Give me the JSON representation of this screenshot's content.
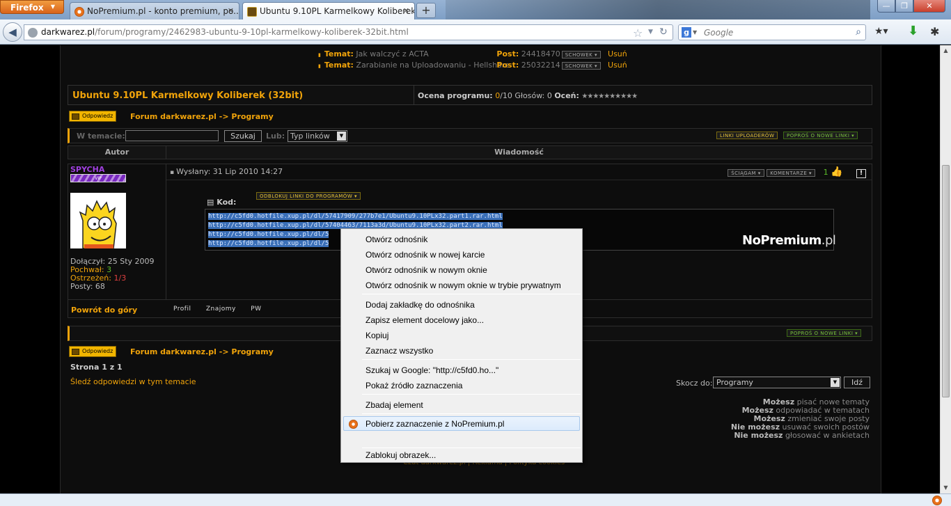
{
  "browser": {
    "app_button": "Firefox",
    "tabs": [
      {
        "title": "NoPremium.pl - konto premium, po...",
        "active": false
      },
      {
        "title": "Ubuntu 9.10PL Karmelkowy Koliberek...",
        "active": true
      }
    ],
    "url_host": "darkwarez.pl",
    "url_path": "/forum/programy/2462983-ubuntu-9-10pl-karmelkowy-koliberek-32bit.html",
    "search_placeholder": "Google",
    "window_controls": {
      "minimize": "—",
      "maximize": "❐",
      "close": "✕"
    }
  },
  "related": [
    {
      "label": "Temat:",
      "title": "Jak walczyć z ACTA",
      "post_label": "Post:",
      "post": "24418470",
      "clip": "SCHOWEK ▾",
      "remove": "Usuń"
    },
    {
      "label": "Temat:",
      "title": "Zarabianie na Uploadowaniu - Hellshare",
      "post_label": "Post:",
      "post": "25032214",
      "clip": "SCHOWEK ▾",
      "remove": "Usuń"
    }
  ],
  "topic": {
    "title": "Ubuntu 9.10PL Karmelkowy Koliberek (32bit)",
    "rating_label": "Ocena programu:",
    "rating_value": "0",
    "rating_max": "/10",
    "votes": "Głosów: 0",
    "rate_label": "Oceń:",
    "stars": "★★★★★★★★★★"
  },
  "nav": {
    "reply_button": "Odpowiedz",
    "crumb_forum": "Forum darkwarez.pl",
    "crumb_sep": "->",
    "crumb_section": "Programy"
  },
  "search": {
    "label": "W temacie:",
    "button": "Szukaj",
    "or_label": "Lub:",
    "select_value": "Typ linków",
    "uploaders_button": "LINKI UPLOADERÓW",
    "request_links_button": "POPROŚ O NOWE LINKI ▾"
  },
  "table": {
    "author_header": "Autor",
    "message_header": "Wiadomość"
  },
  "post": {
    "author": "SPYCHA",
    "badge": "VIP",
    "joined": "Dołączył: 25 Sty 2009",
    "praise_label": "Pochwał:",
    "praise": "3",
    "warnings_label": "Ostrzeżeń:",
    "warnings": "1/3",
    "posts": "Posty: 68",
    "posted": "Wysłany: 31 Lip 2010 14:27",
    "download_button": "ŚCIĄGAM ▾",
    "comments_button": "KOMENTARZE ▾",
    "thumbs": "1",
    "report": "!",
    "code_label": "Kod:",
    "unlock_button": "ODBLOKUJ LINKI DO PROGRAMÓW ▾",
    "code_lines": [
      "http://c5fd0.hotfile.xup.pl/dl/57417909/277b7e1/Ubuntu9.10PLx32.part1.rar.html",
      "http://c5fd0.hotfile.xup.pl/dl/57404463/7113a3d/Ubuntu9.10PLx32.part2.rar.html",
      "http://c5fd0.hotfile.xup.pl/dl/5",
      "http://c5fd0.hotfile.xup.pl/dl/5"
    ],
    "watermark_main": "NoPremium",
    "watermark_tld": ".pl"
  },
  "post_footer": {
    "back_to_top": "Powrót do góry",
    "profile": "Profil",
    "friends": "Znajomy",
    "pm": "PW"
  },
  "pagination": "Strona 1 z 1",
  "follow": "Śledź odpowiedzi w tym temacie",
  "jump": {
    "label": "Skocz do:",
    "value": "Programy",
    "button": "Idź"
  },
  "permissions": [
    {
      "who": "Możesz",
      "what": "pisać nowe tematy"
    },
    {
      "who": "Możesz",
      "what": "odpowiadać w tematach"
    },
    {
      "who": "Możesz",
      "what": "zmieniać swoje posty"
    },
    {
      "who": "Nie możesz",
      "what": "usuwać swoich postów"
    },
    {
      "who": "Nie możesz",
      "what": "głosować w ankietach"
    }
  ],
  "footer": "Czat darkwarez.pl | Reklama | Polityka cookies",
  "context_menu": [
    "Otwórz odnośnik",
    "Otwórz odnośnik w nowej karcie",
    "Otwórz odnośnik w nowym oknie",
    "Otwórz odnośnik w nowym oknie w trybie prywatnym",
    "Dodaj zakładkę do odnośnika",
    "Zapisz element docelowy jako...",
    "Kopiuj",
    "Zaznacz wszystko",
    "Szukaj w Google: \"http://c5fd0.ho...\"",
    "Pokaż źródło zaznaczenia",
    "Zbadaj element",
    "Pobierz zaznaczenie z NoPremium.pl",
    "Zablokuj obrazek..."
  ]
}
